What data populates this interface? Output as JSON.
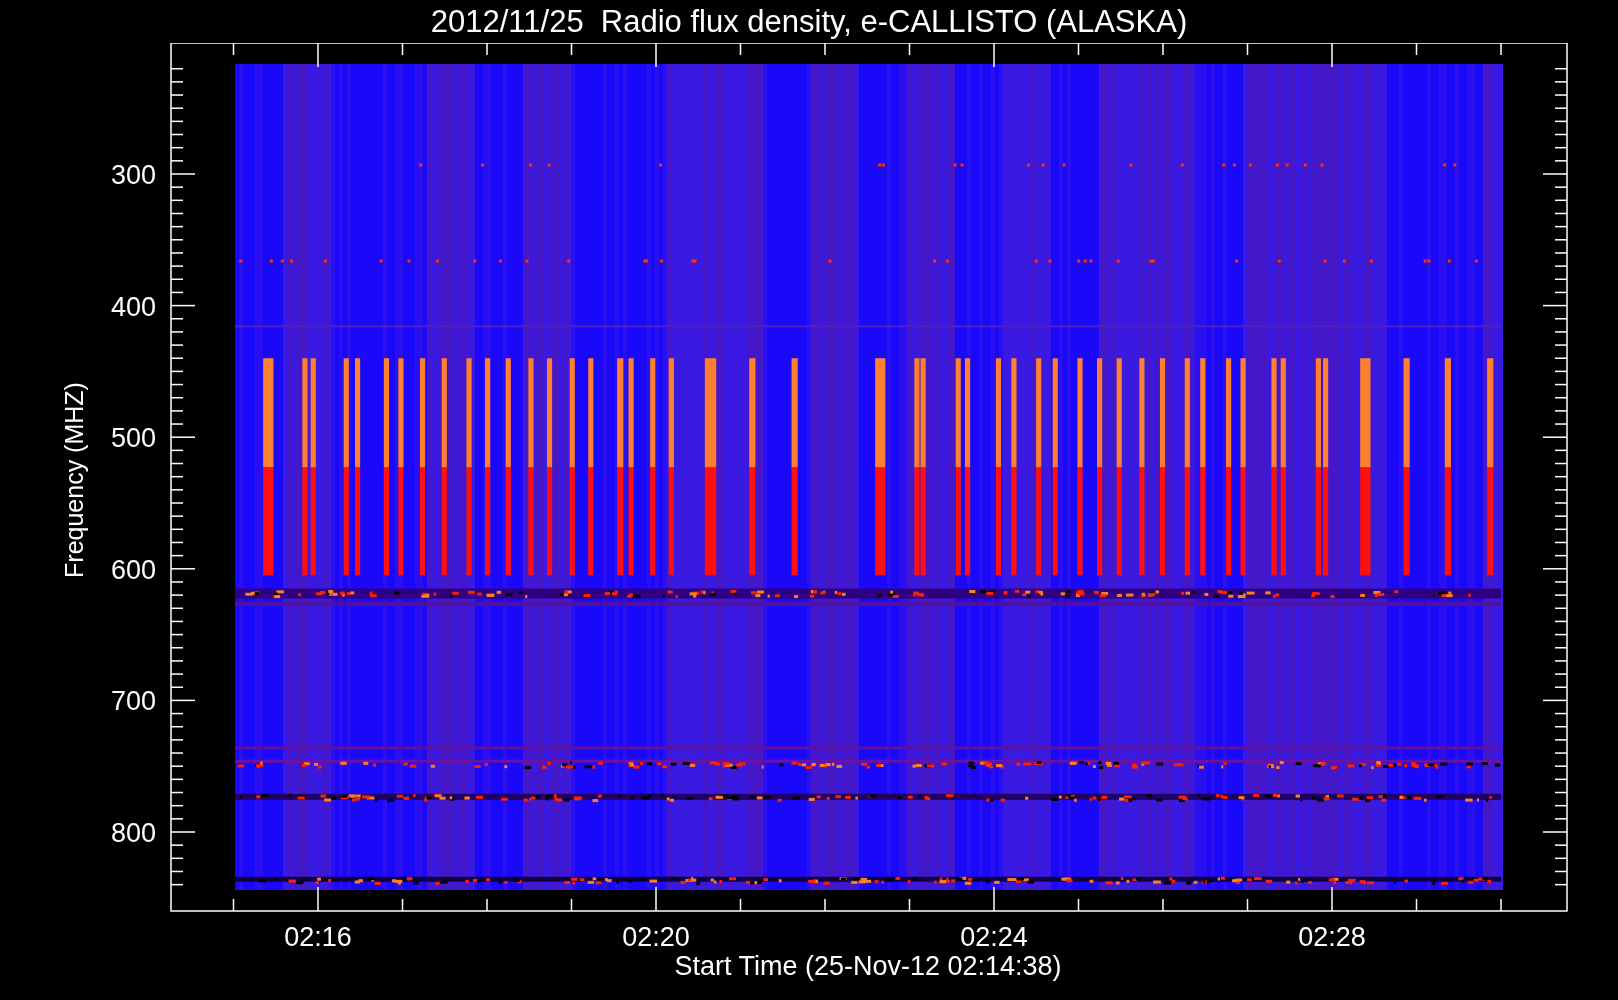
{
  "title": "2012/11/25  Radio flux density, e-CALLISTO (ALASKA)",
  "y_axis": {
    "label": "Frequency (MHZ)",
    "ticks": [
      "300",
      "400",
      "500",
      "600",
      "700",
      "800"
    ]
  },
  "x_axis": {
    "label": "Start Time (25-Nov-12 02:14:38)",
    "ticks": [
      "02:16",
      "02:20",
      "02:24",
      "02:28"
    ]
  }
}
